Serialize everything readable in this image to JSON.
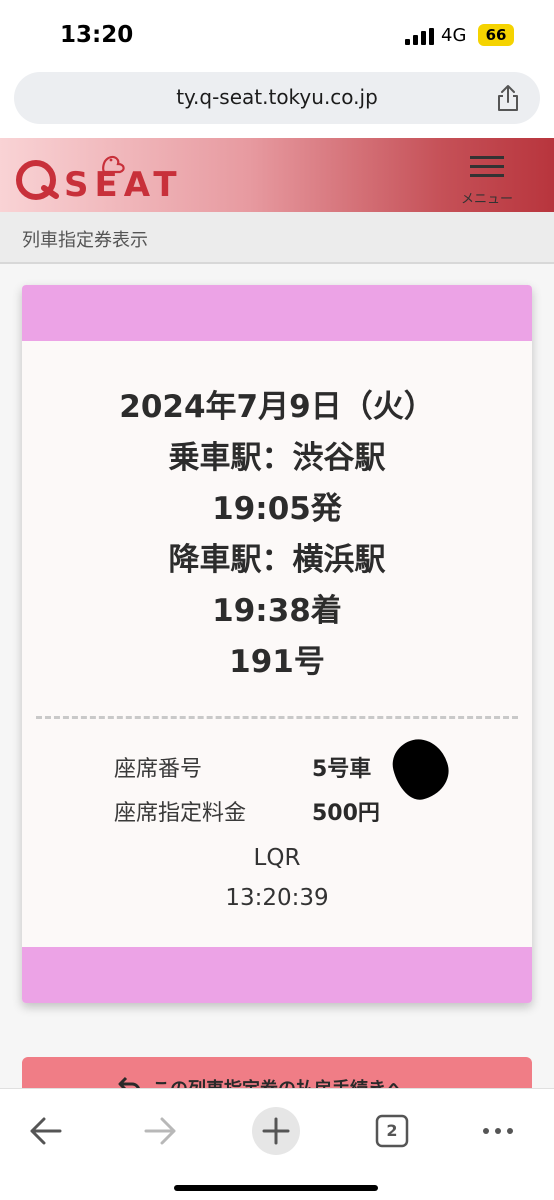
{
  "status_bar": {
    "time": "13:20",
    "network": "4G",
    "battery": "66"
  },
  "browser": {
    "url": "ty.q-seat.tokyu.co.jp",
    "tab_count": "2"
  },
  "header": {
    "logo_text": "QSEAT",
    "menu_label": "メニュー"
  },
  "breadcrumb": "列車指定券表示",
  "ticket": {
    "date": "2024年7月9日（火）",
    "boarding": "乗車駅：渋谷駅",
    "departure": "19:05発",
    "alighting": "降車駅：横浜駅",
    "arrival": "19:38着",
    "train_no": "191号",
    "seat_label": "座席番号",
    "seat_value": "5号車",
    "fee_label": "座席指定料金",
    "fee_value": "500円",
    "code": "LQR",
    "timestamp": "13:20:39"
  },
  "refund_button": {
    "label": "この列車指定券の払戻手続きへ"
  },
  "colors": {
    "ticket_band": "#eca3e6",
    "brand_red": "#c8303a",
    "refund_button": "#f07d86"
  }
}
